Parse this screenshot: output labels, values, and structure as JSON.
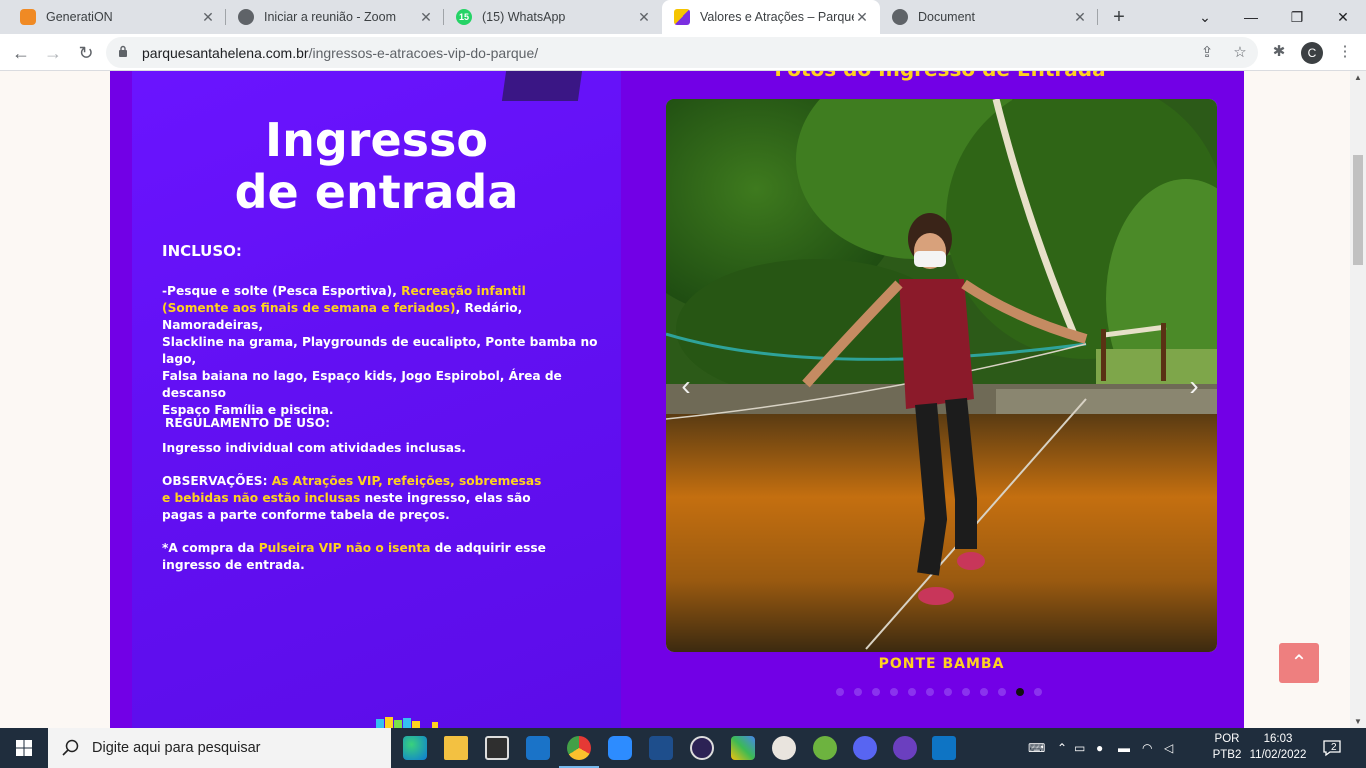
{
  "browser": {
    "tabs": [
      {
        "title": "Generati​ON",
        "icon": "cloud-icon",
        "color": "#f08a24"
      },
      {
        "title": "Iniciar a reunião - Zoom",
        "icon": "globe-icon",
        "color": "#5f6368"
      },
      {
        "title": "(15) WhatsApp",
        "icon": "whatsapp-icon",
        "color": "#25d366",
        "badge": "15"
      },
      {
        "title": "Valores e Atrações – Parque Sa",
        "icon": "park-icon",
        "color": "#7b2fe0"
      },
      {
        "title": "Document",
        "icon": "globe-icon",
        "color": "#5f6368"
      }
    ],
    "url_host": "parquesantahelena.com.br",
    "url_path": "/ingressos-e-atracoes-vip-do-parque/",
    "profile_initial": "C"
  },
  "page": {
    "flyer": {
      "title_line1": "Ingresso",
      "title_line2": "de entrada",
      "included_heading": "INCLUSO:",
      "included": {
        "p1": "-Pesque e solte ",
        "p2": "(Pesca Esportiva)",
        "p3": ", ",
        "p4": "Recreação infantil",
        "p5": "(Somente aos finais de semana e feriados)",
        "p6": ", Redário, Namoradeiras,",
        "p7": "Slackline na grama, Playgrounds de eucalipto, Ponte bamba no lago,",
        "p8": "Falsa baiana no lago, Espaço kids, Jogo Espirobol, Área de descanso",
        "p9": "Espaço Família",
        "p10": " e piscina."
      },
      "rules_heading": "REGULAMENTO DE USO:",
      "rules_text": "Ingresso individual com atividades inclusas.",
      "obs": {
        "label": "OBSERVAÇÕES: ",
        "y1": "As Atrações VIP, refeições, sobremesas",
        "y2": "e bebidas não estão inclusas",
        "w1": " neste ingresso, elas são",
        "w2": "pagas a parte conforme tabela de preços."
      },
      "note": {
        "a": "*A compra da ",
        "b": "Pulseira VIP",
        "c": " ",
        "d": "não o isenta",
        "e": " de adquirir esse",
        "f": "ingresso de entrada."
      }
    },
    "gallery": {
      "title": "Fotos do Ingresso de Entrada",
      "caption": "PONTE BAMBA",
      "dot_count": 12,
      "active_dot": 10
    }
  },
  "taskbar": {
    "search_placeholder": "Digite aqui para pesquisar",
    "lang_line1": "POR",
    "lang_line2": "PTB2",
    "time": "16:03",
    "date": "11/02/2022",
    "notifications": "2"
  }
}
